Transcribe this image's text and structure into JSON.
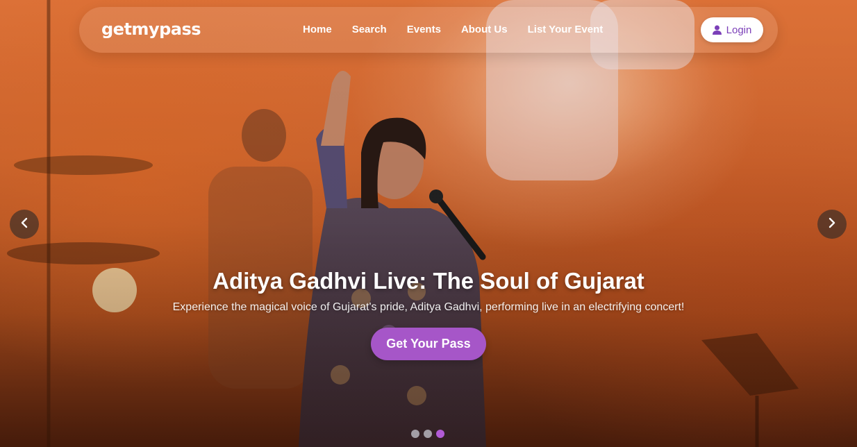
{
  "brand": {
    "logo": "getmypass"
  },
  "nav": {
    "links": [
      "Home",
      "Search",
      "Events",
      "About Us",
      "List Your Event"
    ],
    "login_label": "Login"
  },
  "hero": {
    "title": "Aditya Gadhvi Live: The Soul of Gujarat",
    "subtitle": "Experience the magical voice of Gujarat's pride, Aditya Gadhvi, performing live in an electrifying concert!",
    "cta_label": "Get Your Pass",
    "slide_count": 3,
    "active_slide": 3
  },
  "colors": {
    "accent": "#a656c8",
    "login_text": "#7b3fb8",
    "dot_active": "#b15bd6"
  },
  "icons": {
    "login": "user-icon",
    "prev": "chevron-left-icon",
    "next": "chevron-right-icon"
  }
}
